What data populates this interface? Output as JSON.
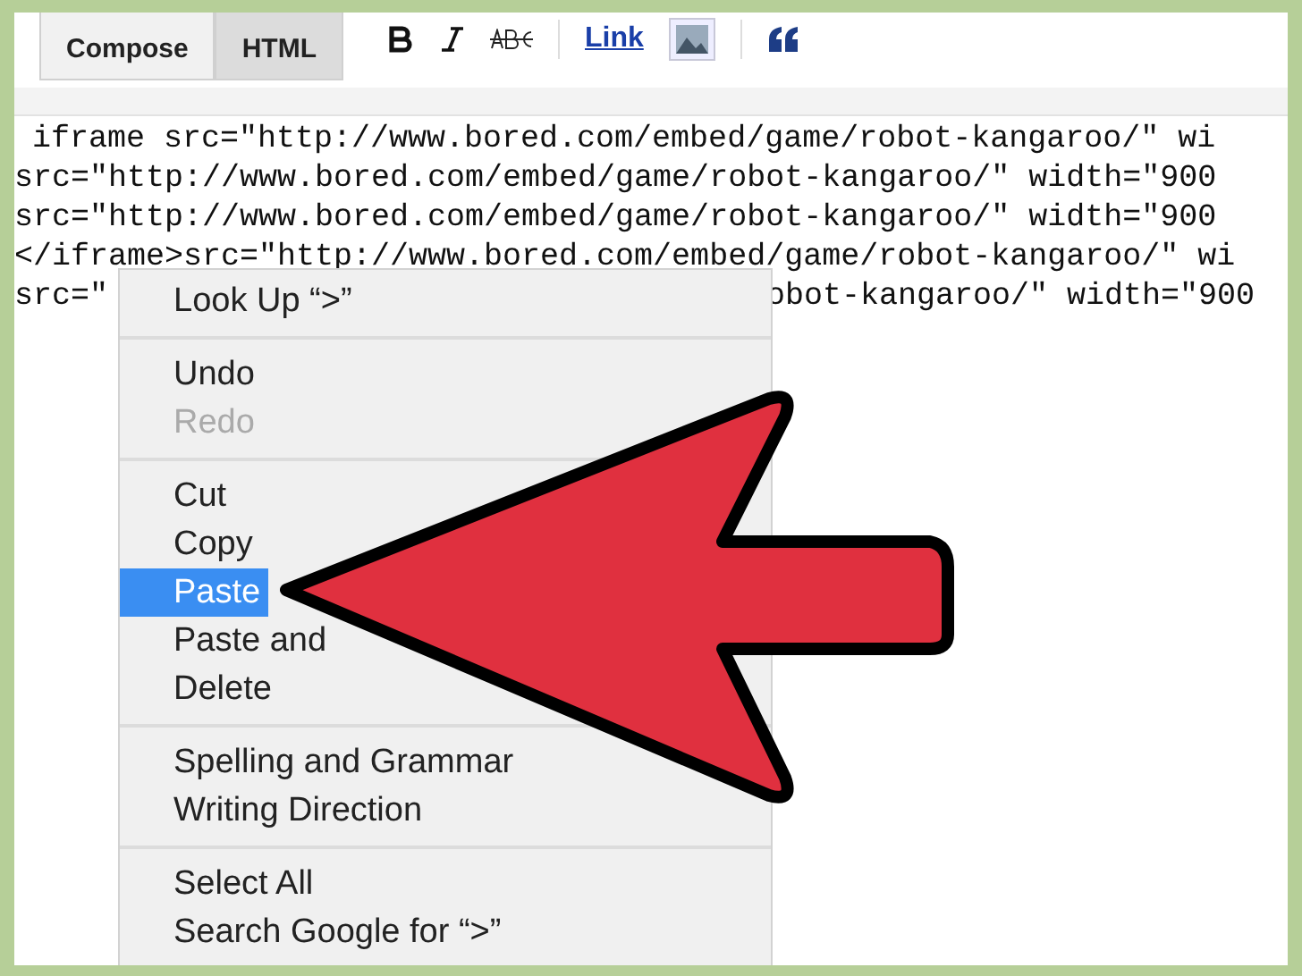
{
  "editor_tabs": [
    {
      "label": "Compose",
      "selected": false
    },
    {
      "label": "HTML",
      "selected": true
    }
  ],
  "toolbar": {
    "link": "Link"
  },
  "code_lines": [
    "iframe src=\"http://www.bored.com/embed/game/robot-kangaroo/\" wi",
    "src=\"http://www.bored.com/embed/game/robot-kangaroo/\" width=\"900",
    "src=\"http://www.bored.com/embed/game/robot-kangaroo/\" width=\"900",
    "</iframe>src=\"http://www.bored.com/embed/game/robot-kangaroo/\" wi"
  ],
  "code_line_partial": {
    "left": "src=\"",
    "right": "obot-kangaroo/\" width=\"900"
  },
  "context_menu": [
    {
      "kind": "item",
      "label": "Look Up “>”",
      "disabled": false,
      "selected": false
    },
    {
      "kind": "separator"
    },
    {
      "kind": "item",
      "label": "Undo",
      "disabled": false,
      "selected": false
    },
    {
      "kind": "item",
      "label": "Redo",
      "disabled": true,
      "selected": false
    },
    {
      "kind": "separator"
    },
    {
      "kind": "item",
      "label": "Cut",
      "disabled": false,
      "selected": false
    },
    {
      "kind": "item",
      "label": "Copy",
      "disabled": false,
      "selected": false
    },
    {
      "kind": "item",
      "label": "Paste",
      "disabled": false,
      "selected": true
    },
    {
      "kind": "item",
      "label": "Paste and",
      "disabled": false,
      "selected": false
    },
    {
      "kind": "item",
      "label": "Delete",
      "disabled": false,
      "selected": false
    },
    {
      "kind": "separator"
    },
    {
      "kind": "item",
      "label": "Spelling and Grammar",
      "disabled": false,
      "selected": false
    },
    {
      "kind": "item",
      "label": "Writing Direction",
      "disabled": false,
      "selected": false
    },
    {
      "kind": "separator"
    },
    {
      "kind": "item",
      "label": "Select All",
      "disabled": false,
      "selected": false
    },
    {
      "kind": "item",
      "label": "Search Google for “>”",
      "disabled": false,
      "selected": false
    }
  ]
}
